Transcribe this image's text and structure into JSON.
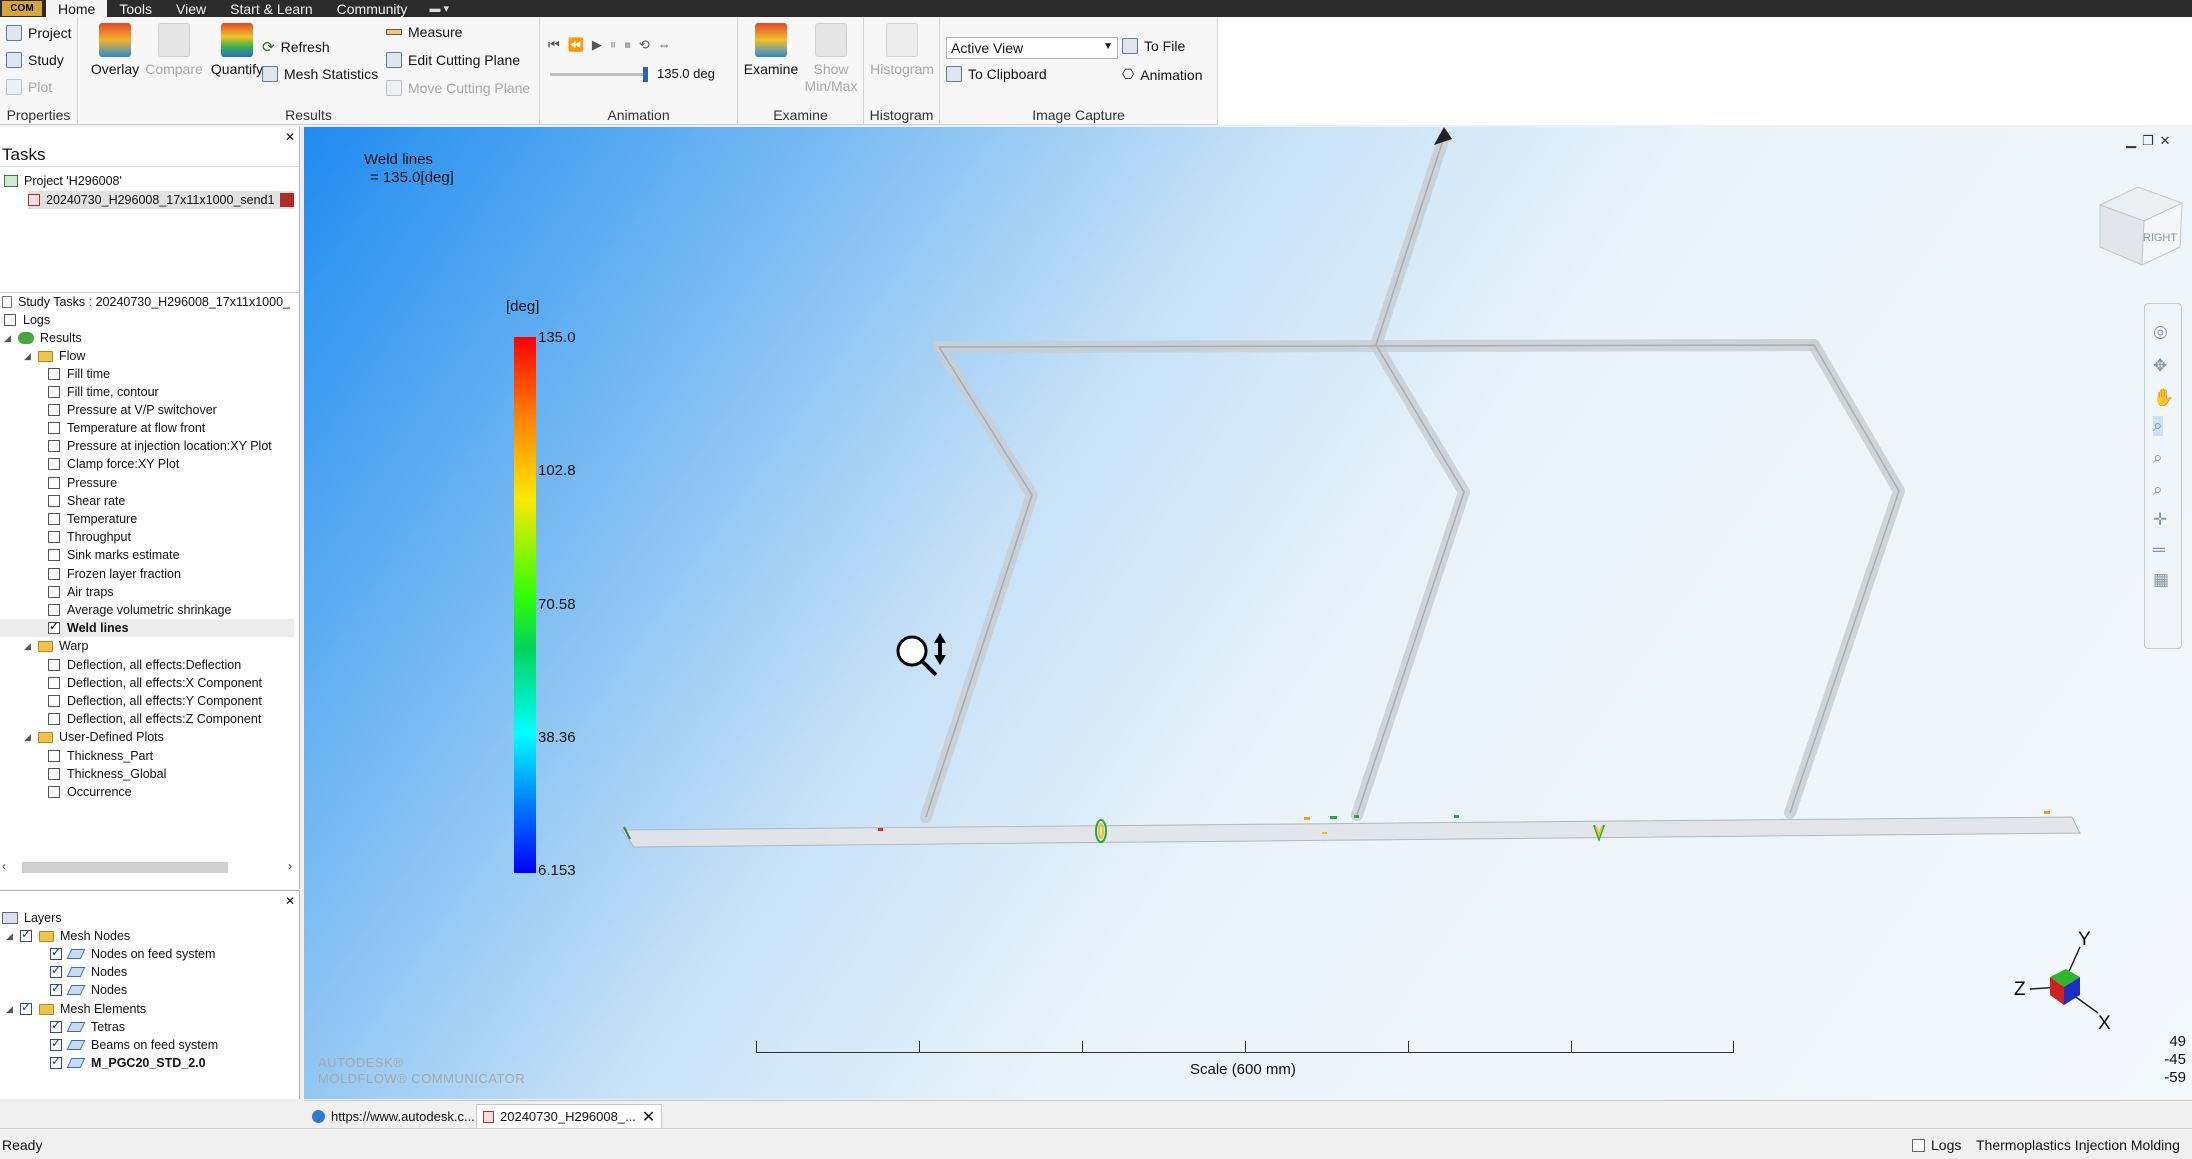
{
  "menubar": {
    "app_button": "COM",
    "tabs": [
      "Home",
      "Tools",
      "View",
      "Start & Learn",
      "Community"
    ],
    "active_tab": "Home",
    "quick_access": "▾"
  },
  "ribbon": {
    "properties": {
      "label": "Properties",
      "project": "Project",
      "study": "Study",
      "plot": "Plot"
    },
    "results": {
      "label": "Results",
      "overlay": "Overlay",
      "compare": "Compare",
      "quantify": "Quantify",
      "refresh": "Refresh",
      "mesh_statistics": "Mesh Statistics",
      "measure": "Measure",
      "edit_cutting_plane": "Edit Cutting Plane",
      "move_cutting_plane": "Move Cutting Plane"
    },
    "animation": {
      "label": "Animation",
      "value": "135.0 deg",
      "slider_fraction": 1.0
    },
    "examine": {
      "label": "Examine",
      "examine": "Examine",
      "show_minmax_line1": "Show",
      "show_minmax_line2": "Min/Max"
    },
    "histogram": {
      "label": "Histogram",
      "histogram": "Histogram"
    },
    "image_capture": {
      "label": "Image Capture",
      "view_select": "Active View",
      "to_file": "To File",
      "to_clipboard": "To Clipboard",
      "animation": "Animation"
    }
  },
  "tasks": {
    "title": "Tasks",
    "project": "Project 'H296008'",
    "study_file": "20240730_H296008_17x11x1000_send1",
    "study_tasks": "Study Tasks : 20240730_H296008_17x11x1000_",
    "logs": "Logs",
    "results": "Results",
    "flow_folder": "Flow",
    "flow_items": [
      {
        "label": "Fill time",
        "checked": false
      },
      {
        "label": "Fill time, contour",
        "checked": false
      },
      {
        "label": "Pressure at V/P switchover",
        "checked": false
      },
      {
        "label": "Temperature at flow front",
        "checked": false
      },
      {
        "label": "Pressure at injection location:XY Plot",
        "checked": false
      },
      {
        "label": "Clamp force:XY Plot",
        "checked": false
      },
      {
        "label": "Pressure",
        "checked": false
      },
      {
        "label": "Shear rate",
        "checked": false
      },
      {
        "label": "Temperature",
        "checked": false
      },
      {
        "label": "Throughput",
        "checked": false
      },
      {
        "label": "Sink marks estimate",
        "checked": false
      },
      {
        "label": "Frozen layer fraction",
        "checked": false
      },
      {
        "label": "Air traps",
        "checked": false
      },
      {
        "label": "Average volumetric shrinkage",
        "checked": false
      },
      {
        "label": "Weld lines",
        "checked": true
      }
    ],
    "warp_folder": "Warp",
    "warp_items": [
      {
        "label": "Deflection, all effects:Deflection",
        "checked": false
      },
      {
        "label": "Deflection, all effects:X Component",
        "checked": false
      },
      {
        "label": "Deflection, all effects:Y Component",
        "checked": false
      },
      {
        "label": "Deflection, all effects:Z Component",
        "checked": false
      }
    ],
    "udp_folder": "User-Defined Plots",
    "udp_items": [
      {
        "label": "Thickness_Part",
        "checked": false
      },
      {
        "label": "Thickness_Global",
        "checked": false
      },
      {
        "label": "Occurrence",
        "checked": false
      }
    ]
  },
  "layers": {
    "title": "Layers",
    "mesh_nodes": "Mesh Nodes",
    "node_items": [
      "Nodes on feed system",
      "Nodes",
      "Nodes"
    ],
    "mesh_elements": "Mesh Elements",
    "element_items": [
      "Tetras",
      "Beams on feed system",
      "M_PGC20_STD_2.0"
    ]
  },
  "viewport": {
    "result_title": "Weld lines",
    "result_value": "= 135.0[deg]",
    "legend_unit": "[deg]",
    "legend_ticks": [
      "135.0",
      "102.8",
      "70.58",
      "38.36",
      "6.153"
    ],
    "scale_label": "Scale (600 mm)",
    "watermark_line1": "AUTODESK®",
    "watermark_line2": "MOLDFLOW® COMMUNICATOR",
    "viewcube_label": "RIGHT",
    "axes": {
      "y": "Y",
      "z": "Z",
      "x": "X"
    },
    "coords": [
      "49",
      "-45",
      "-59"
    ]
  },
  "doc_tabs": {
    "web": "https://www.autodesk.c...",
    "study": "20240730_H296008_..."
  },
  "status": {
    "left": "Ready",
    "logs": "Logs",
    "module": "Thermoplastics Injection Molding"
  }
}
